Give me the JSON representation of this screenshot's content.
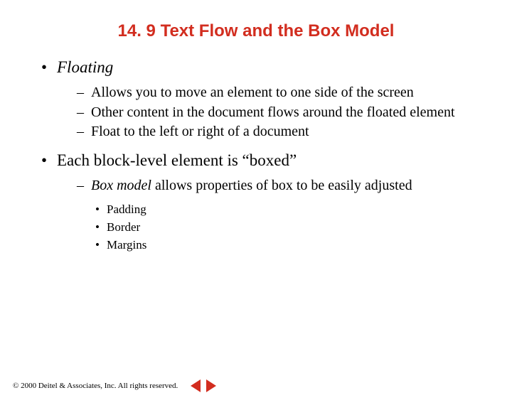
{
  "title": "14. 9 Text Flow and the Box Model",
  "b1": {
    "head": "Floating",
    "subs": [
      "Allows you to move an element to one side of the screen",
      "Other content in the document flows around the floated element",
      "Float to the left or right of a document"
    ]
  },
  "b2": {
    "head": "Each block-level element is “boxed”",
    "sub_prefix_ital": "Box model",
    "sub_rest": " allows properties of box to be easily adjusted",
    "l3": [
      "Padding",
      "Border",
      "Margins"
    ]
  },
  "footer": "© 2000 Deitel & Associates, Inc.  All rights reserved."
}
